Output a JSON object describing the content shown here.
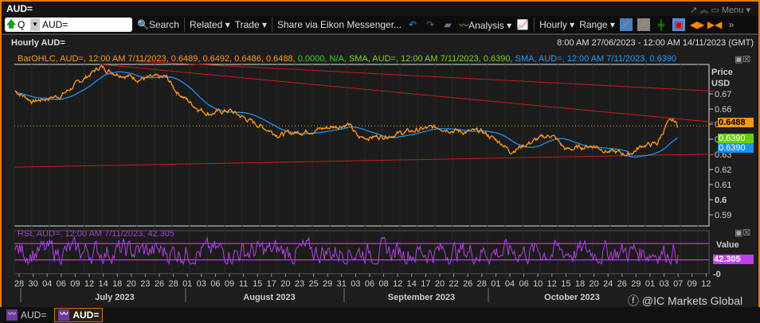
{
  "window": {
    "title": "AUD=",
    "menu": "Menu"
  },
  "toolbar": {
    "ric_value": "AUD=",
    "q_label": "Q",
    "search": "Search",
    "related": "Related",
    "trade": "Trade",
    "share": "Share via Eikon Messenger...",
    "analysis": "Analysis",
    "interval": "Hourly",
    "range": "Range"
  },
  "chart": {
    "title": "Hourly AUD=",
    "date_range": "8:00 AM 27/06/2023 - 12:00 AM 14/11/2023 (GMT)",
    "legend": {
      "bar": "BarOHLC, AUD=, 12:00 AM 7/11/2023, 0.6489, 0.6492, 0.6486, 0.6488,",
      "chg": "0.0000, N/A,",
      "sma1": "SMA, AUD=, 12:00 AM 7/11/2023, 0.6390,",
      "sma2": "SMA, AUD=, 12:00 AM 7/11/2023, 0.6390"
    },
    "rsi_legend": "RSI, AUD=, 12:00 AM 7/11/2023, 42.305",
    "price_axis_title": "Price",
    "currency": "USD",
    "rsi_axis_title": "Value",
    "badges": {
      "last": "0.6488",
      "sma1": "0.6390",
      "sma2": "0.6390",
      "rsi": "42.305"
    },
    "colors": {
      "price": "#ff9a1a",
      "sma1": "#7ed321",
      "sma2": "#1e9bff",
      "rsi": "#b040e0",
      "trend": "#d01818"
    }
  },
  "chart_data": {
    "type": "line",
    "y_ticks": [
      "0.67",
      "0.66",
      "0.65",
      "0.64",
      "0.63",
      "0.62",
      "0.61",
      "0.6",
      "0.59"
    ],
    "ylim": [
      0.585,
      0.6925
    ],
    "x_ticks": [
      "28",
      "30",
      "04",
      "06",
      "09",
      "12",
      "14",
      "18",
      "20",
      "23",
      "26",
      "28",
      "01",
      "03",
      "06",
      "09",
      "11",
      "15",
      "17",
      "20",
      "23",
      "25",
      "29",
      "31",
      "03",
      "06",
      "08",
      "12",
      "14",
      "17",
      "20",
      "22",
      "26",
      "28",
      "01",
      "04",
      "06",
      "10",
      "12",
      "15",
      "18",
      "20",
      "24",
      "26",
      "29",
      "01",
      "03",
      "07",
      "09",
      "12"
    ],
    "months": [
      "July 2023",
      "August 2023",
      "September 2023",
      "October 2023"
    ],
    "price_keypoints_by_tick_index": [
      [
        -0.3,
        0.672
      ],
      [
        1,
        0.665
      ],
      [
        3,
        0.669
      ],
      [
        5.8,
        0.688
      ],
      [
        6.5,
        0.685
      ],
      [
        8.5,
        0.68
      ],
      [
        10.5,
        0.681
      ],
      [
        11.2,
        0.672
      ],
      [
        12.5,
        0.662
      ],
      [
        13.5,
        0.657
      ],
      [
        15,
        0.659
      ],
      [
        16.5,
        0.652
      ],
      [
        18.5,
        0.643
      ],
      [
        21,
        0.646
      ],
      [
        23.5,
        0.65
      ],
      [
        24.2,
        0.641
      ],
      [
        26,
        0.642
      ],
      [
        29,
        0.647
      ],
      [
        30,
        0.648
      ],
      [
        31.5,
        0.645
      ],
      [
        33,
        0.645
      ],
      [
        34.5,
        0.637
      ],
      [
        35,
        0.632
      ],
      [
        37,
        0.64
      ],
      [
        38,
        0.643
      ],
      [
        39,
        0.633
      ],
      [
        41,
        0.636
      ],
      [
        42,
        0.632
      ],
      [
        43.5,
        0.63
      ],
      [
        44.5,
        0.636
      ],
      [
        45.5,
        0.637
      ],
      [
        46.2,
        0.65
      ],
      [
        46.7,
        0.652
      ],
      [
        47,
        0.6488
      ]
    ],
    "trendlines": [
      {
        "from": [
          5.8,
          0.6895
        ],
        "to": [
          49.6,
          0.6512
        ]
      },
      {
        "from": [
          8.5,
          0.6915
        ],
        "to": [
          49.6,
          0.6718
        ]
      },
      {
        "from": [
          -0.3,
          0.6215
        ],
        "to": [
          49.6,
          0.6302
        ]
      }
    ],
    "last_price": 0.6488,
    "sma_last": 0.639,
    "rsi_last": 42.305,
    "rsi_bands": [
      70,
      30
    ]
  },
  "taskbar": [
    {
      "label": "AUD="
    },
    {
      "label": "AUD="
    }
  ],
  "watermark": "@IC Markets Global"
}
